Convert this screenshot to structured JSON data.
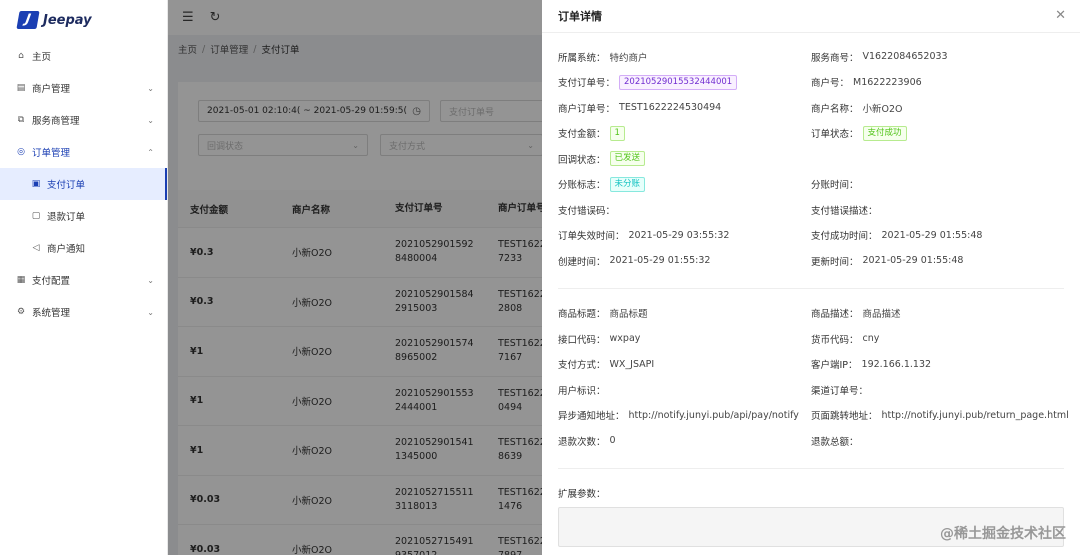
{
  "app": {
    "logo_letter": "J",
    "name": "Jeepay"
  },
  "sidebar": {
    "items": [
      {
        "label": "主页",
        "icon": "home-icon",
        "glyph": "⌂",
        "has_chevron": false
      },
      {
        "label": "商户管理",
        "icon": "merchant-icon",
        "glyph": "▤",
        "has_chevron": true
      },
      {
        "label": "服务商管理",
        "icon": "isv-icon",
        "glyph": "⧉",
        "has_chevron": true
      },
      {
        "label": "订单管理",
        "icon": "order-icon",
        "glyph": "◎",
        "has_chevron": true,
        "open": true
      },
      {
        "label": "支付订单",
        "icon": "pay-order-icon",
        "glyph": "▣",
        "sub": true,
        "active": true
      },
      {
        "label": "退款订单",
        "icon": "refund-icon",
        "glyph": "▢",
        "sub": true
      },
      {
        "label": "商户通知",
        "icon": "notify-icon",
        "glyph": "◁",
        "sub": true
      },
      {
        "label": "支付配置",
        "icon": "pay-config-icon",
        "glyph": "▦",
        "has_chevron": true
      },
      {
        "label": "系统管理",
        "icon": "system-icon",
        "glyph": "⚙",
        "has_chevron": true
      }
    ]
  },
  "breadcrumb": {
    "home": "主页",
    "sep": "/",
    "section": "订单管理",
    "current": "支付订单"
  },
  "filters": {
    "date_range": "2021-05-01 02:10:4( ~ 2021-05-29 01:59:5(",
    "order_no_placeholder": "支付订单号",
    "status_placeholder": "回调状态",
    "way_placeholder": "支付方式"
  },
  "table": {
    "headers": [
      "支付金额",
      "商户名称",
      "支付订单号",
      "商户订单号"
    ],
    "rows": [
      {
        "amount": "¥0.3",
        "merchant": "小新O2O",
        "order_no_1": "2021052901592",
        "order_no_2": "8480004",
        "mch_no_1": "TEST1622",
        "mch_no_2": "7233"
      },
      {
        "amount": "¥0.3",
        "merchant": "小新O2O",
        "order_no_1": "2021052901584",
        "order_no_2": "2915003",
        "mch_no_1": "TEST1622",
        "mch_no_2": "2808"
      },
      {
        "amount": "¥1",
        "merchant": "小新O2O",
        "order_no_1": "2021052901574",
        "order_no_2": "8965002",
        "mch_no_1": "TEST1622",
        "mch_no_2": "7167"
      },
      {
        "amount": "¥1",
        "merchant": "小新O2O",
        "order_no_1": "2021052901553",
        "order_no_2": "2444001",
        "mch_no_1": "TEST1622",
        "mch_no_2": "0494"
      },
      {
        "amount": "¥1",
        "merchant": "小新O2O",
        "order_no_1": "2021052901541",
        "order_no_2": "1345000",
        "mch_no_1": "TEST1622",
        "mch_no_2": "8639"
      },
      {
        "amount": "¥0.03",
        "merchant": "小新O2O",
        "order_no_1": "2021052715511",
        "order_no_2": "3118013",
        "mch_no_1": "TEST1622",
        "mch_no_2": "1476"
      },
      {
        "amount": "¥0.03",
        "merchant": "小新O2O",
        "order_no_1": "2021052715491",
        "order_no_2": "9357012",
        "mch_no_1": "TEST1622",
        "mch_no_2": "7897"
      }
    ]
  },
  "drawer": {
    "title": "订单详情",
    "fields": [
      {
        "label": "所属系统：",
        "value": "特约商户"
      },
      {
        "label": "服务商号：",
        "value": "V1622084652033"
      },
      {
        "label": "支付订单号：",
        "value": "20210529015532444001",
        "tag": "purple"
      },
      {
        "label": "商户号：",
        "value": "M1622223906"
      },
      {
        "label": "商户订单号：",
        "value": "TEST1622224530494"
      },
      {
        "label": "商户名称：",
        "value": "小新O2O"
      },
      {
        "label": "支付金额：",
        "value": "1",
        "tag": "green"
      },
      {
        "label": "订单状态：",
        "value": "支付成功",
        "tag": "green"
      },
      {
        "label": "回调状态：",
        "value": "已发送",
        "tag": "green"
      },
      {
        "label": "",
        "value": ""
      },
      {
        "label": "分账标志：",
        "value": "未分账",
        "tag": "cyan"
      },
      {
        "label": "分账时间：",
        "value": ""
      },
      {
        "label": "支付错误码：",
        "value": ""
      },
      {
        "label": "支付错误描述：",
        "value": ""
      },
      {
        "label": "订单失效时间：",
        "value": "2021-05-29 03:55:32"
      },
      {
        "label": "支付成功时间：",
        "value": "2021-05-29 01:55:48"
      },
      {
        "label": "创建时间：",
        "value": "2021-05-29 01:55:32"
      },
      {
        "label": "更新时间：",
        "value": "2021-05-29 01:55:48"
      }
    ],
    "fields2": [
      {
        "label": "商品标题：",
        "value": "商品标题"
      },
      {
        "label": "商品描述：",
        "value": "商品描述"
      },
      {
        "label": "接口代码：",
        "value": "wxpay"
      },
      {
        "label": "货币代码：",
        "value": "cny"
      },
      {
        "label": "支付方式：",
        "value": "WX_JSAPI"
      },
      {
        "label": "客户端IP：",
        "value": "192.166.1.132"
      },
      {
        "label": "用户标识：",
        "value": ""
      },
      {
        "label": "渠道订单号：",
        "value": ""
      },
      {
        "label": "异步通知地址：",
        "value": "http://notify.junyi.pub/api/pay/notify"
      },
      {
        "label": "页面跳转地址：",
        "value": "http://notify.junyi.pub/return_page.html"
      },
      {
        "label": "退款次数：",
        "value": "0"
      },
      {
        "label": "退款总额：",
        "value": ""
      }
    ],
    "ext_label": "扩展参数："
  },
  "watermark": "@稀土掘金技术社区"
}
